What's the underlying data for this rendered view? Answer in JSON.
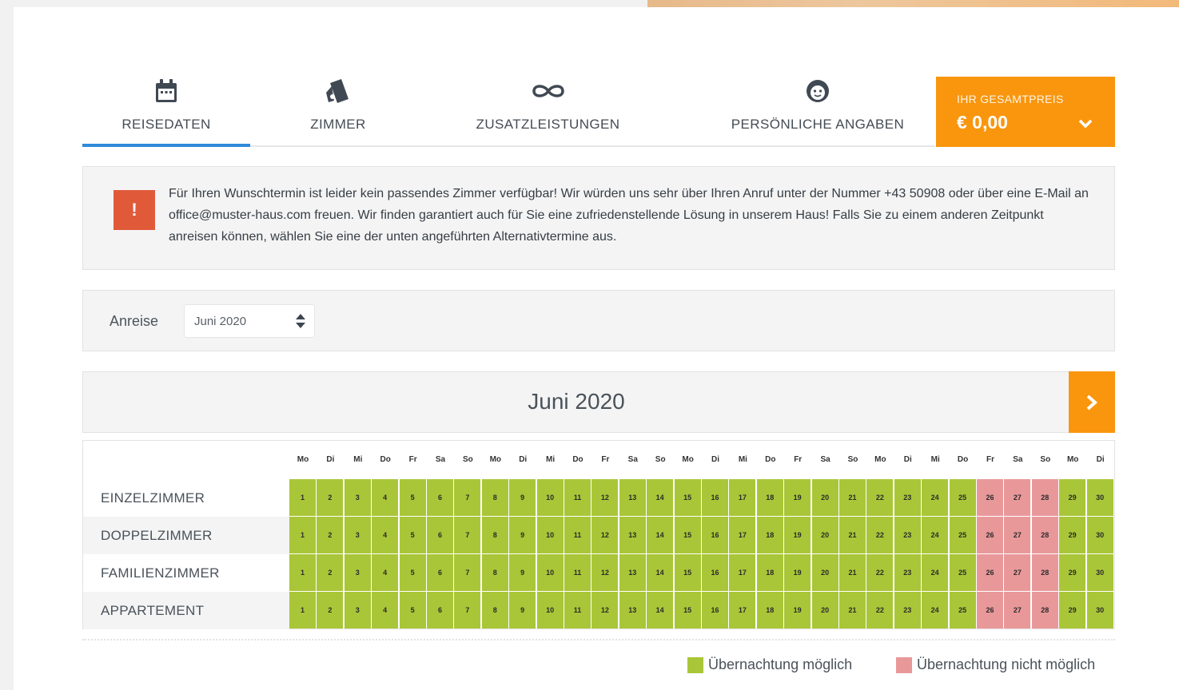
{
  "steps": [
    {
      "label": "REISEDATEN",
      "icon": "calendar-icon",
      "active": true
    },
    {
      "label": "ZIMMER",
      "icon": "room-icon",
      "active": false
    },
    {
      "label": "ZUSATZLEISTUNGEN",
      "icon": "infinity-icon",
      "active": false
    },
    {
      "label": "PERSÖNLICHE ANGABEN",
      "icon": "face-icon",
      "active": false
    }
  ],
  "price": {
    "label": "IHR GESAMTPREIS",
    "value": "€ 0,00"
  },
  "alert": {
    "icon": "!",
    "text": "Für Ihren Wunschtermin ist leider kein passendes Zimmer verfügbar! Wir würden uns sehr über Ihren Anruf unter der Nummer +43 50908 oder über eine E-Mail an office@muster-haus.com freuen. Wir finden garantiert auch für Sie eine zufriedenstellende Lösung in unserem Haus! Falls Sie zu einem anderen Zeitpunkt anreisen können, wählen Sie eine der unten angeführten Alternativtermine aus."
  },
  "arrival": {
    "label": "Anreise",
    "selected": "Juni 2020"
  },
  "calendar": {
    "month": "Juni 2020",
    "weekdays": [
      "Mo",
      "Di",
      "Mi",
      "Do",
      "Fr",
      "Sa",
      "So",
      "Mo",
      "Di",
      "Mi",
      "Do",
      "Fr",
      "Sa",
      "So",
      "Mo",
      "Di",
      "Mi",
      "Do",
      "Fr",
      "Sa",
      "So",
      "Mo",
      "Di",
      "Mi",
      "Do",
      "Fr",
      "Sa",
      "So",
      "Mo",
      "Di"
    ],
    "days": [
      "1",
      "2",
      "3",
      "4",
      "5",
      "6",
      "7",
      "8",
      "9",
      "10",
      "11",
      "12",
      "13",
      "14",
      "15",
      "16",
      "17",
      "18",
      "19",
      "20",
      "21",
      "22",
      "23",
      "24",
      "25",
      "26",
      "27",
      "28",
      "29",
      "30"
    ],
    "unavailable_days": [
      26,
      27,
      28
    ],
    "rooms": [
      "EINZELZIMMER",
      "DOPPELZIMMER",
      "FAMILIENZIMMER",
      "APPARTEMENT"
    ]
  },
  "legend": [
    {
      "label": "Übernachtung möglich",
      "color": "#a9c638"
    },
    {
      "label": "Übernachtung nicht möglich",
      "color": "#e9989a"
    }
  ],
  "colors": {
    "accent": "#f9960e",
    "active_tab": "#2f8ad9",
    "alert": "#e05a3a",
    "available": "#a9c638",
    "unavailable": "#e9989a"
  }
}
